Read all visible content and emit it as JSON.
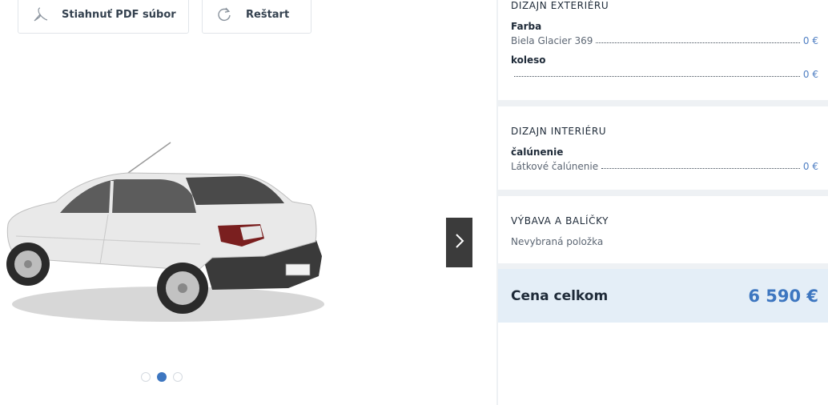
{
  "toolbar": {
    "pdf_label": "Stiahnuť PDF súbor",
    "reset_label": "Reštart"
  },
  "gallery": {
    "active_index": 1,
    "dot_count": 3
  },
  "summary": {
    "exterior": {
      "title": "DIZAJN EXTERIÉRU",
      "paint_label": "Farba",
      "paint_value": "Biela Glacier 369",
      "paint_price": "0 €",
      "wheel_label": "koleso",
      "wheel_value": "",
      "wheel_price": "0 €"
    },
    "interior": {
      "title": "DIZAJN INTERIÉRU",
      "upholstery_label": "čalúnenie",
      "upholstery_value": "Látkové čalúnenie",
      "upholstery_price": "0 €"
    },
    "equipment": {
      "title": "VÝBAVA A BALÍČKY",
      "empty_text": "Nevybraná položka"
    },
    "total": {
      "label": "Cena celkom",
      "value": "6 590 €"
    }
  },
  "colors": {
    "accent": "#3d76c0",
    "price": "#4f7fc3",
    "total_bg": "#e4eef7"
  }
}
